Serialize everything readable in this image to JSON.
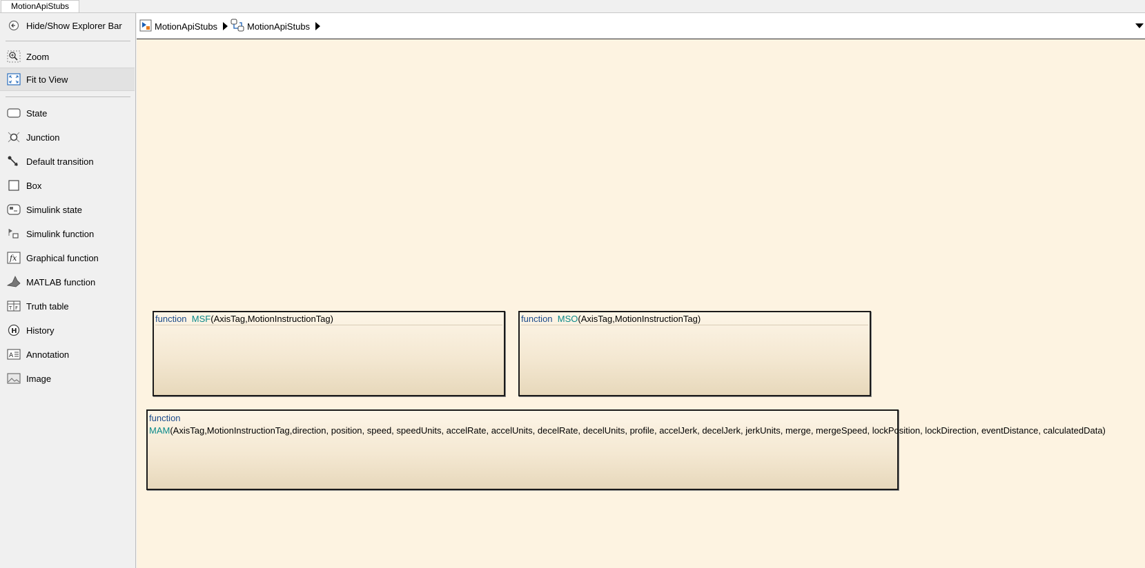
{
  "tab": {
    "title": "MotionApiStubs"
  },
  "palette": {
    "items": [
      {
        "label": "Hide/Show Explorer Bar",
        "icon": "back-circle-icon"
      },
      {
        "label": "Zoom",
        "icon": "zoom-icon"
      },
      {
        "label": "Fit to View",
        "icon": "fit-to-view-icon"
      },
      {
        "label": "State",
        "icon": "state-icon"
      },
      {
        "label": "Junction",
        "icon": "junction-icon"
      },
      {
        "label": "Default transition",
        "icon": "default-transition-icon"
      },
      {
        "label": "Box",
        "icon": "box-icon"
      },
      {
        "label": "Simulink state",
        "icon": "simulink-state-icon"
      },
      {
        "label": "Simulink function",
        "icon": "simulink-function-icon"
      },
      {
        "label": "Graphical function",
        "icon": "graphical-function-icon"
      },
      {
        "label": "MATLAB function",
        "icon": "matlab-function-icon"
      },
      {
        "label": "Truth table",
        "icon": "truth-table-icon"
      },
      {
        "label": "History",
        "icon": "history-icon"
      },
      {
        "label": "Annotation",
        "icon": "annotation-icon"
      },
      {
        "label": "Image",
        "icon": "image-icon"
      }
    ]
  },
  "breadcrumb": {
    "items": [
      {
        "label": "MotionApiStubs",
        "icon": "model-icon"
      },
      {
        "label": "MotionApiStubs",
        "icon": "chart-icon"
      }
    ]
  },
  "canvas": {
    "functions": [
      {
        "keyword": "function",
        "name": "MSF",
        "args": "(AxisTag,MotionInstructionTag)"
      },
      {
        "keyword": "function",
        "name": "MSO",
        "args": "(AxisTag,MotionInstructionTag)"
      },
      {
        "keyword": "function",
        "name": "MAM",
        "args": "(AxisTag,MotionInstructionTag,direction, position, speed, speedUnits, accelRate, accelUnits, decelRate, decelUnits, profile, accelJerk, decelJerk, jerkUnits, merge, mergeSpeed, lockPosition, lockDirection, eventDistance, calculatedData)"
      }
    ]
  },
  "colors": {
    "canvas_bg": "#fdf3e1",
    "keyword": "#1a4a8a",
    "function_name": "#0b8a8a"
  }
}
